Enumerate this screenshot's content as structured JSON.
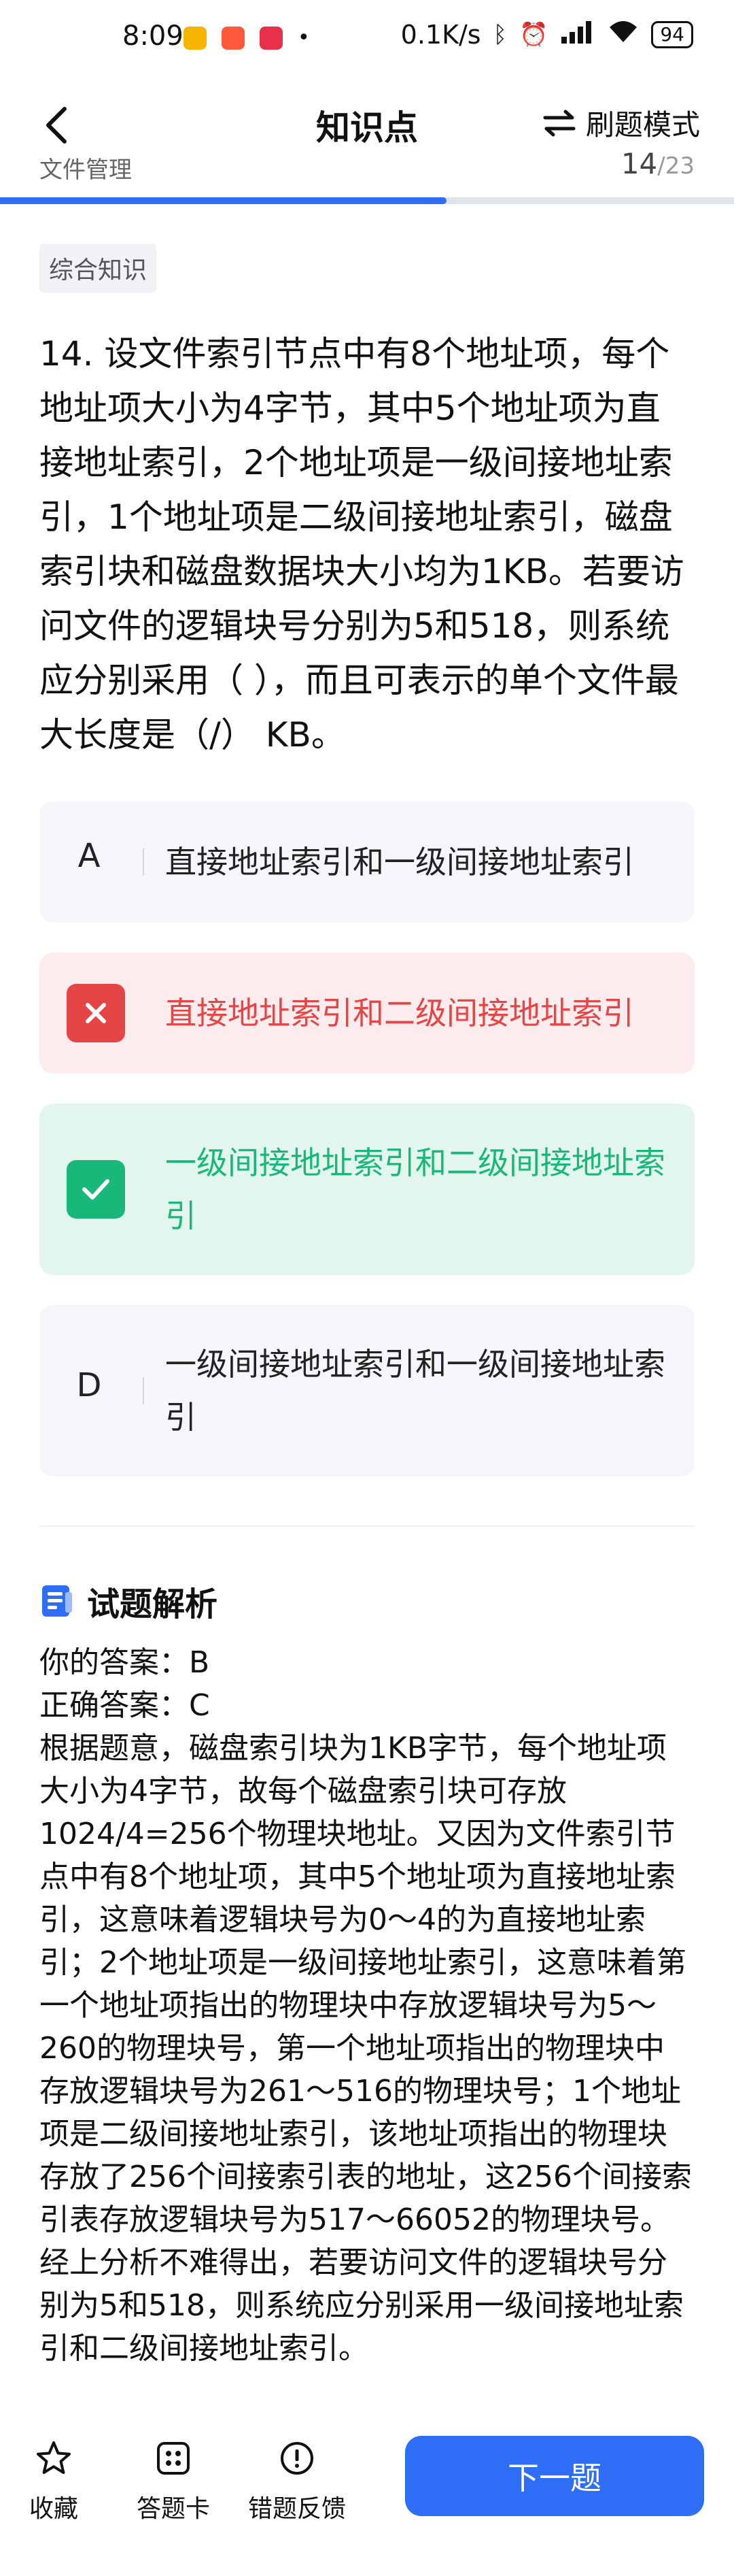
{
  "status_bar": {
    "time": "8:09",
    "network": "0.1K/s",
    "battery": "94",
    "app_colors": [
      "#f5b400",
      "#ff5a3c",
      "#e8304a"
    ]
  },
  "header": {
    "title": "知识点",
    "mode_label": "刷题模式"
  },
  "progress": {
    "chapter": "文件管理",
    "current": "14",
    "total": "/23",
    "fraction": 0.6087
  },
  "question": {
    "tag": "综合知识",
    "text": "14. 设文件索引节点中有8个地址项，每个地址项大小为4字节，其中5个地址项为直接地址索引，2个地址项是一级间接地址索引，1个地址项是二级间接地址索引，磁盘索引块和磁盘数据块大小均为1KB。若要访问文件的逻辑块号分别为5和518，则系统应分别采用（ ），而且可表示的单个文件最大长度是（/） KB。"
  },
  "options": [
    {
      "letter": "A",
      "text": "直接地址索引和一级间接地址索引",
      "state": "normal"
    },
    {
      "letter": "B",
      "text": "直接地址索引和二级间接地址索引",
      "state": "wrong"
    },
    {
      "letter": "C",
      "text": "一级间接地址索引和二级间接地址索引",
      "state": "correct"
    },
    {
      "letter": "D",
      "text": "一级间接地址索引和一级间接地址索引",
      "state": "normal"
    }
  ],
  "colors": {
    "accent": "#2e6df5",
    "wrong": "#e64545",
    "correct": "#19b77a"
  },
  "analysis": {
    "title": "试题解析",
    "your_answer": "你的答案：B",
    "correct_answer": "正确答案：C",
    "explanation": "根据题意，磁盘索引块为1KB字节，每个地址项大小为4字节，故每个磁盘索引块可存放1024/4=256个物理块地址。又因为文件索引节点中有8个地址项，其中5个地址项为直接地址索引，这意味着逻辑块号为0～4的为直接地址索引；2个地址项是一级间接地址索引，这意味着第一个地址项指出的物理块中存放逻辑块号为5～260的物理块号，第一个地址项指出的物理块中存放逻辑块号为261～516的物理块号；1个地址项是二级间接地址索引，该地址项指出的物理块存放了256个间接索引表的地址，这256个间接索引表存放逻辑块号为517～66052的物理块号。",
    "conclusion": "经上分析不难得出，若要访问文件的逻辑块号分别为5和518，则系统应分别采用一级间接地址索引和二级间接地址索引。"
  },
  "bottom_bar": {
    "favorite": "收藏",
    "answer_card": "答题卡",
    "feedback": "错题反馈",
    "next": "下一题"
  }
}
